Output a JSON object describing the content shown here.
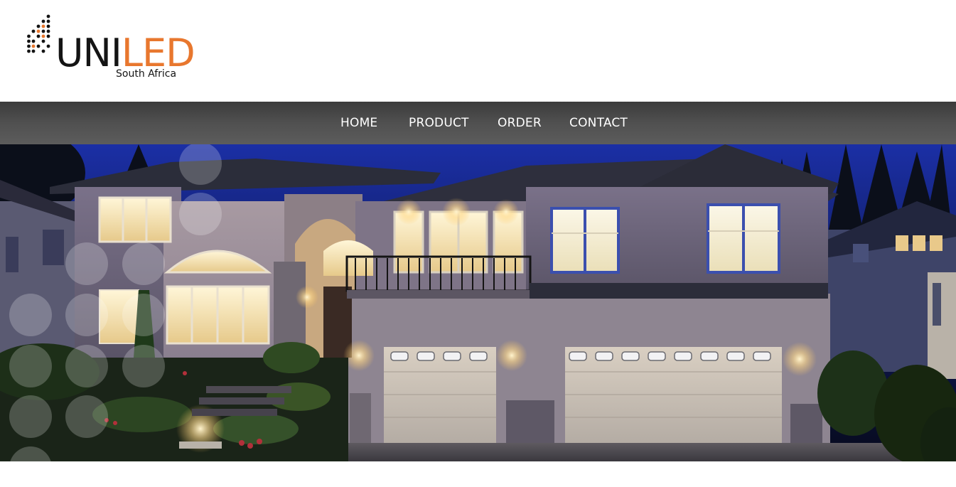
{
  "logo": {
    "brand_part1": "UNI",
    "brand_part2": "LED",
    "subtitle": "South Africa",
    "icon": "led-dot-matrix-icon"
  },
  "nav": {
    "items": [
      {
        "label": "HOME"
      },
      {
        "label": "PRODUCT"
      },
      {
        "label": "ORDER"
      },
      {
        "label": "CONTACT"
      }
    ]
  },
  "hero": {
    "image": "house-at-night-photo"
  },
  "colors": {
    "brand_orange": "#e8772e",
    "brand_dark": "#141414",
    "nav_bg": "#4a4a4a",
    "nav_text": "#ffffff",
    "sky": "#1a2a8a",
    "window_glow": "#f6e7b8"
  }
}
